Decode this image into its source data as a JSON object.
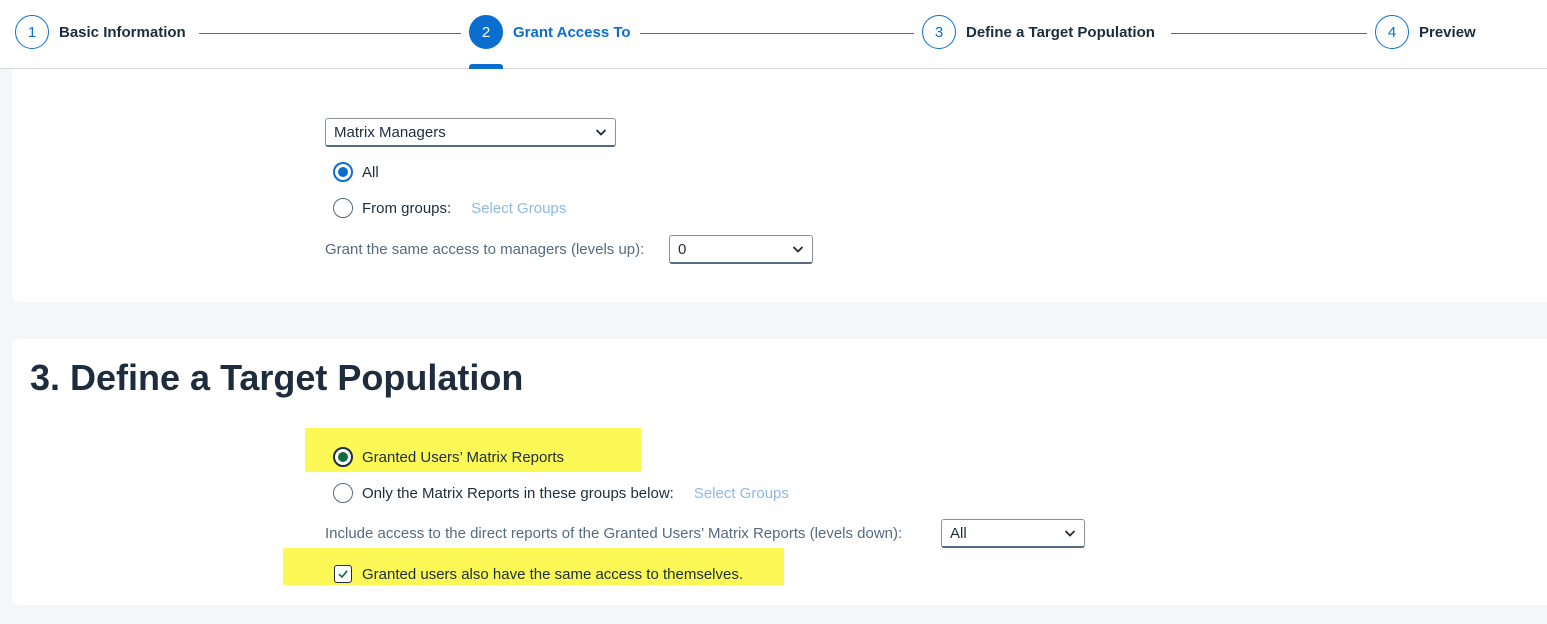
{
  "wizard": {
    "steps": [
      {
        "number": "1",
        "label": "Basic Information"
      },
      {
        "number": "2",
        "label": "Grant Access To"
      },
      {
        "number": "3",
        "label": "Define a Target Population"
      },
      {
        "number": "4",
        "label": "Preview"
      }
    ],
    "active_step": 2
  },
  "grant_section": {
    "group_select_value": "Matrix Managers",
    "option_all": "All",
    "option_from_groups": "From groups:",
    "select_groups_link": "Select Groups",
    "managers_levels_label": "Grant the same access to managers (levels up):",
    "managers_levels_value": "0"
  },
  "target_section": {
    "title": "3. Define a Target Population",
    "option_matrix_reports": "Granted Users’ Matrix Reports",
    "option_groups_below": "Only the Matrix Reports in these groups below:",
    "select_groups_link": "Select Groups",
    "levels_down_label": "Include access to the direct reports of the Granted Users’ Matrix Reports (levels down):",
    "levels_down_value": "All",
    "self_access_label": "Granted users also have the same access to themselves."
  },
  "colors": {
    "accent": "#0a6ed1",
    "highlight": "#fcf855",
    "link": "#8db9e6"
  }
}
